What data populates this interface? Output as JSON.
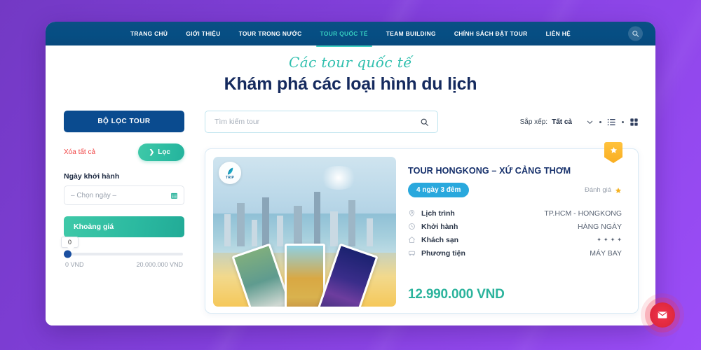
{
  "nav": {
    "items": [
      {
        "label": "TRANG CHỦ",
        "active": false
      },
      {
        "label": "GIỚI THIỆU",
        "active": false
      },
      {
        "label": "TOUR TRONG NƯỚC",
        "active": false
      },
      {
        "label": "TOUR QUỐC TẾ",
        "active": true
      },
      {
        "label": "TEAM BUILDING",
        "active": false
      },
      {
        "label": "CHÍNH SÁCH ĐẶT TOUR",
        "active": false
      },
      {
        "label": "LIÊN HỆ",
        "active": false
      }
    ],
    "search_icon": "search-icon"
  },
  "hero": {
    "script_title": "Các tour quốc tế",
    "main_title": "Khám phá các loại hình du lịch"
  },
  "sidebar": {
    "filter_button": "BỘ LỌC TOUR",
    "clear_all": "Xóa tất cả",
    "apply_button": "Lọc",
    "apply_chevron": "❯",
    "date_label": "Ngày khởi hành",
    "date_placeholder": "– Chọn ngày –",
    "calendar_icon": "calendar-icon",
    "price_section": "Khoảng giá",
    "slider_tooltip": "0",
    "price_min": "0 VND",
    "price_max": "20.000.000 VND"
  },
  "toolbar": {
    "search_placeholder": "Tìm kiếm tour",
    "search_value": "",
    "sort_label": "Sắp xếp:",
    "sort_value": "Tất cả",
    "chevron_icon": "chevron-down-icon",
    "list_view_icon": "list-view-icon",
    "grid_view_icon": "grid-view-icon"
  },
  "card": {
    "ribbon_icon": "star-badge-icon",
    "logo_text": "TRIP",
    "title": "TOUR HONGKONG – XỨ CẢNG THƠM",
    "duration_badge": "4 ngày 3 đêm",
    "rating_label": "Đánh giá",
    "rating_icon": "star-icon",
    "details": [
      {
        "icon": "location-pin-icon",
        "label": "Lịch trình",
        "value": "TP.HCM - HONGKONG"
      },
      {
        "icon": "clock-icon",
        "label": "Khởi hành",
        "value": "HÀNG NGÀY"
      },
      {
        "icon": "hotel-icon",
        "label": "Khách sạn",
        "value": "",
        "stars": 4
      },
      {
        "icon": "transport-icon",
        "label": "Phương tiện",
        "value": "MÁY BAY"
      }
    ],
    "price": "12.990.000 VND"
  },
  "chat": {
    "icon": "envelope-icon"
  },
  "colors": {
    "page_background": "#8340dd",
    "header_navy": "#064e83",
    "accent_teal": "#2bb39c",
    "active_nav": "#36cfc0",
    "badge_blue": "#29a8dd",
    "title_navy": "#16306b",
    "danger_red": "#f04444",
    "ribbon_gold": "#f9ae22",
    "chat_red": "#e0293f"
  }
}
